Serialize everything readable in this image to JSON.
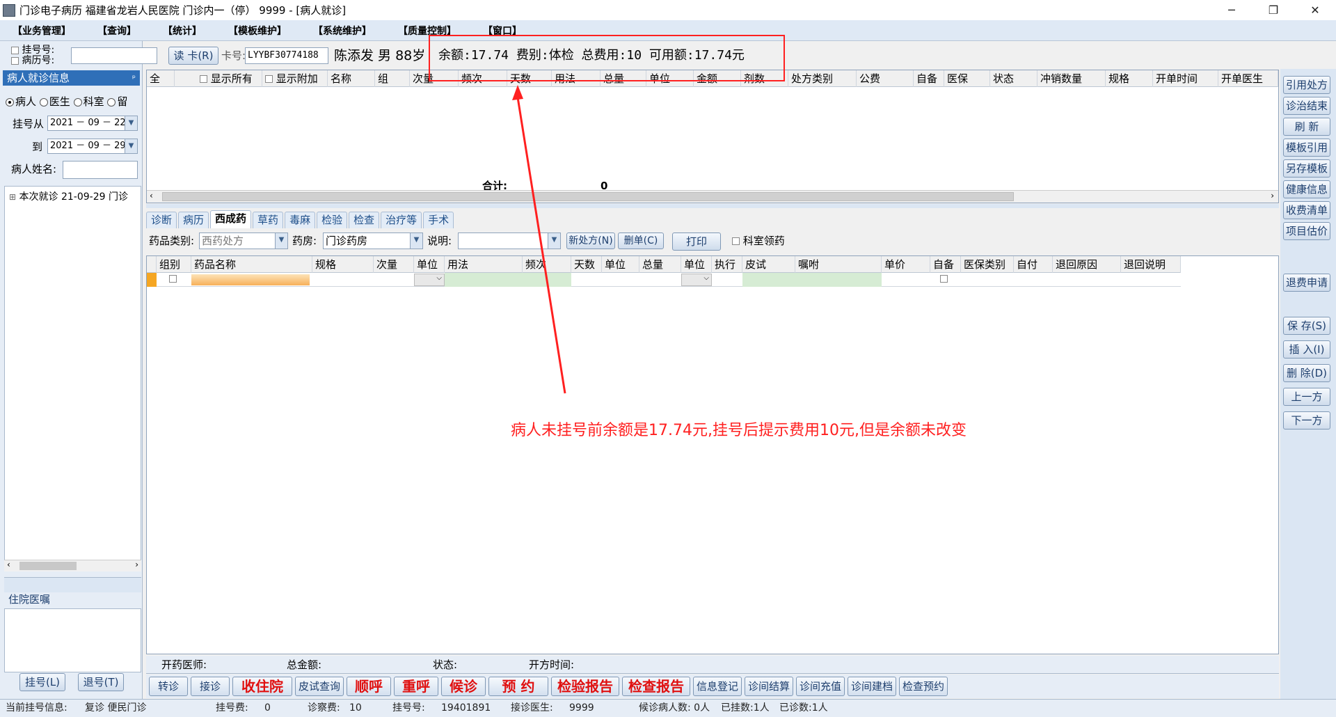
{
  "window": {
    "title": "门诊电子病历  福建省龙岩人民医院  门诊内一（停）  9999 - [病人就诊]",
    "minimize": "─",
    "restore": "❐",
    "close": "✕"
  },
  "menu": [
    "【业务管理】",
    "【查询】",
    "【统计】",
    "【模板维护】",
    "【系统维护】",
    "【质量控制】",
    "【窗口】"
  ],
  "left": {
    "reg_no_label": "挂号号:",
    "record_no_label": "病历号:",
    "panel_title": "病人就诊信息",
    "pin": "ᵖ",
    "radios": [
      "病人",
      "医生",
      "科室",
      "留"
    ],
    "from_label": "挂号从",
    "from_date": "2021 － 09 － 22",
    "to_label": "到",
    "to_date": "2021 － 09 － 29",
    "name_label": "病人姓名:",
    "tree_item": "本次就诊  21-09-29  门诊",
    "tree_expand": "⊞",
    "inpatient_label": "住院医嘱",
    "register_btn": "挂号(L)",
    "unregister_btn": "退号(T)"
  },
  "cardbar": {
    "read_card_btn": "读 卡(R)",
    "card_label": "卡号:",
    "card_no": "LYYBF30774188",
    "patient_info": "陈添发  男  88岁",
    "balance_info": "余额:17.74  费别:体检  总费用:10  可用额:17.74元"
  },
  "topgrid": {
    "headers": [
      "全",
      "显示所有",
      "显示附加",
      "名称",
      "组",
      "次量",
      "频次",
      "天数",
      "用法",
      "总量",
      "单位",
      "金额",
      "剂数",
      "处方类别",
      "公费",
      "自备",
      "医保",
      "状态",
      "冲销数量",
      "规格",
      "开单时间",
      "开单医生"
    ],
    "total_label": "合计:",
    "total_value": "0"
  },
  "tabs": [
    "诊断",
    "病历",
    "西成药",
    "草药",
    "毒麻",
    "检验",
    "检查",
    "治疗等",
    "手术"
  ],
  "toolbar": {
    "drug_type_label": "药品类别:",
    "drug_type_value": "西药处方",
    "pharmacy_label": "药房:",
    "pharmacy_value": "门诊药房",
    "note_label": "说明:",
    "new_rx_btn": "新处方(N)",
    "del_rx_btn": "删单(C)",
    "print_btn": "打印",
    "dept_receive": "科室领药"
  },
  "bottomgrid": {
    "headers": [
      "组别",
      "药品名称",
      "规格",
      "次量",
      "单位",
      "用法",
      "频次",
      "天数",
      "单位",
      "总量",
      "单位",
      "执行",
      "皮试",
      "嘱咐",
      "单价",
      "自备",
      "医保类别",
      "自付",
      "退回原因",
      "退回说明"
    ]
  },
  "status": {
    "doctor_label": "开药医师:",
    "total_label": "总金额:",
    "state_label": "状态:",
    "time_label": "开方时间:"
  },
  "actions": [
    {
      "label": "转诊",
      "red": false
    },
    {
      "label": "接诊",
      "red": false
    },
    {
      "label": "收住院",
      "red": true
    },
    {
      "label": "皮试查询",
      "red": false
    },
    {
      "label": "顺呼",
      "red": true
    },
    {
      "label": "重呼",
      "red": true
    },
    {
      "label": "候诊",
      "red": true
    },
    {
      "label": "预  约",
      "red": true
    },
    {
      "label": "检验报告",
      "red": true
    },
    {
      "label": "检查报告",
      "red": true
    },
    {
      "label": "信息登记",
      "red": false
    },
    {
      "label": "诊间结算",
      "red": false
    },
    {
      "label": "诊间充值",
      "red": false
    },
    {
      "label": "诊间建档",
      "red": false
    },
    {
      "label": "检查预约",
      "red": false
    }
  ],
  "rightbar": [
    "引用处方",
    "诊治结束",
    "刷  新",
    "模板引用",
    "另存模板",
    "健康信息",
    "收费清单",
    "项目估价",
    "退费申请",
    "保 存(S)",
    "插 入(I)",
    "删 除(D)",
    "上一方",
    "下一方"
  ],
  "footer": {
    "reg_info_label": "当前挂号信息:",
    "reg_info_value": "复诊  便民门诊",
    "reg_fee_label": "挂号费:",
    "reg_fee_value": "0",
    "exam_fee_label": "诊察费:",
    "exam_fee_value": "10",
    "reg_no_label": "挂号号:",
    "reg_no_value": "19401891",
    "doctor_label": "接诊医生:",
    "doctor_value": "9999",
    "waiting": "候诊病人数: 0人",
    "registered": "已挂数:1人",
    "diagnosed": "已诊数:1人"
  },
  "annotation": "病人未挂号前余额是17.74元,挂号后提示费用10元,但是余额未改变"
}
